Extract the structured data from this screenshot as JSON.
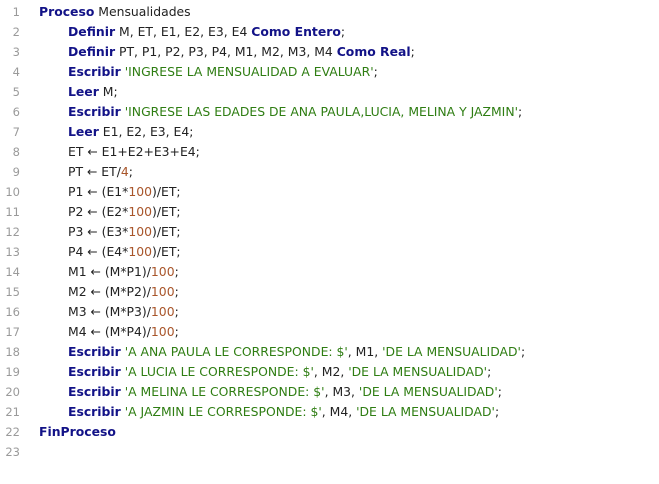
{
  "colors": {
    "keyword": "#121287",
    "string": "#2e7d12",
    "number": "#a8552a",
    "text": "#222222",
    "line_number": "#9a9a9a",
    "background": "#ffffff"
  },
  "lines": [
    {
      "n": "1",
      "indent": 0,
      "tokens": [
        {
          "t": "kw",
          "v": "Proceso"
        },
        {
          "t": "txt",
          "v": " Mensualidades"
        }
      ]
    },
    {
      "n": "2",
      "indent": 1,
      "tokens": [
        {
          "t": "kw",
          "v": "Definir"
        },
        {
          "t": "txt",
          "v": " M, ET, E1, E2, E3, E4 "
        },
        {
          "t": "kw",
          "v": "Como Entero"
        },
        {
          "t": "txt",
          "v": ";"
        }
      ]
    },
    {
      "n": "3",
      "indent": 1,
      "tokens": [
        {
          "t": "kw",
          "v": "Definir"
        },
        {
          "t": "txt",
          "v": " PT, P1, P2, P3, P4, M1, M2, M3, M4 "
        },
        {
          "t": "kw",
          "v": "Como Real"
        },
        {
          "t": "txt",
          "v": ";"
        }
      ]
    },
    {
      "n": "4",
      "indent": 1,
      "tokens": [
        {
          "t": "kw",
          "v": "Escribir"
        },
        {
          "t": "txt",
          "v": " "
        },
        {
          "t": "str",
          "v": "'INGRESE LA MENSUALIDAD A EVALUAR'"
        },
        {
          "t": "txt",
          "v": ";"
        }
      ]
    },
    {
      "n": "5",
      "indent": 1,
      "tokens": [
        {
          "t": "kw",
          "v": "Leer"
        },
        {
          "t": "txt",
          "v": " M;"
        }
      ]
    },
    {
      "n": "6",
      "indent": 1,
      "tokens": [
        {
          "t": "kw",
          "v": "Escribir"
        },
        {
          "t": "txt",
          "v": " "
        },
        {
          "t": "str",
          "v": "'INGRESE LAS EDADES DE ANA PAULA,LUCIA, MELINA Y JAZMIN'"
        },
        {
          "t": "txt",
          "v": ";"
        }
      ]
    },
    {
      "n": "7",
      "indent": 1,
      "tokens": [
        {
          "t": "kw",
          "v": "Leer"
        },
        {
          "t": "txt",
          "v": " E1, E2, E3, E4;"
        }
      ]
    },
    {
      "n": "8",
      "indent": 1,
      "tokens": [
        {
          "t": "txt",
          "v": "ET ← E1+E2+E3+E4;"
        }
      ]
    },
    {
      "n": "9",
      "indent": 1,
      "tokens": [
        {
          "t": "txt",
          "v": "PT ← ET/"
        },
        {
          "t": "num",
          "v": "4"
        },
        {
          "t": "txt",
          "v": ";"
        }
      ]
    },
    {
      "n": "10",
      "indent": 1,
      "tokens": [
        {
          "t": "txt",
          "v": "P1 ← (E1*"
        },
        {
          "t": "num",
          "v": "100"
        },
        {
          "t": "txt",
          "v": ")/ET;"
        }
      ]
    },
    {
      "n": "11",
      "indent": 1,
      "tokens": [
        {
          "t": "txt",
          "v": "P2 ← (E2*"
        },
        {
          "t": "num",
          "v": "100"
        },
        {
          "t": "txt",
          "v": ")/ET;"
        }
      ]
    },
    {
      "n": "12",
      "indent": 1,
      "tokens": [
        {
          "t": "txt",
          "v": "P3 ← (E3*"
        },
        {
          "t": "num",
          "v": "100"
        },
        {
          "t": "txt",
          "v": ")/ET;"
        }
      ]
    },
    {
      "n": "13",
      "indent": 1,
      "tokens": [
        {
          "t": "txt",
          "v": "P4 ← (E4*"
        },
        {
          "t": "num",
          "v": "100"
        },
        {
          "t": "txt",
          "v": ")/ET;"
        }
      ]
    },
    {
      "n": "14",
      "indent": 1,
      "tokens": [
        {
          "t": "txt",
          "v": "M1 ← (M*P1)/"
        },
        {
          "t": "num",
          "v": "100"
        },
        {
          "t": "txt",
          "v": ";"
        }
      ]
    },
    {
      "n": "15",
      "indent": 1,
      "tokens": [
        {
          "t": "txt",
          "v": "M2 ← (M*P2)/"
        },
        {
          "t": "num",
          "v": "100"
        },
        {
          "t": "txt",
          "v": ";"
        }
      ]
    },
    {
      "n": "16",
      "indent": 1,
      "tokens": [
        {
          "t": "txt",
          "v": "M3 ← (M*P3)/"
        },
        {
          "t": "num",
          "v": "100"
        },
        {
          "t": "txt",
          "v": ";"
        }
      ]
    },
    {
      "n": "17",
      "indent": 1,
      "tokens": [
        {
          "t": "txt",
          "v": "M4 ← (M*P4)/"
        },
        {
          "t": "num",
          "v": "100"
        },
        {
          "t": "txt",
          "v": ";"
        }
      ]
    },
    {
      "n": "18",
      "indent": 1,
      "tokens": [
        {
          "t": "kw",
          "v": "Escribir"
        },
        {
          "t": "txt",
          "v": " "
        },
        {
          "t": "str",
          "v": "'A ANA PAULA LE CORRESPONDE: $'"
        },
        {
          "t": "txt",
          "v": ", M1, "
        },
        {
          "t": "str",
          "v": "'DE LA MENSUALIDAD'"
        },
        {
          "t": "txt",
          "v": ";"
        }
      ]
    },
    {
      "n": "19",
      "indent": 1,
      "tokens": [
        {
          "t": "kw",
          "v": "Escribir"
        },
        {
          "t": "txt",
          "v": " "
        },
        {
          "t": "str",
          "v": "'A LUCIA LE CORRESPONDE: $'"
        },
        {
          "t": "txt",
          "v": ", M2, "
        },
        {
          "t": "str",
          "v": "'DE LA MENSUALIDAD'"
        },
        {
          "t": "txt",
          "v": ";"
        }
      ]
    },
    {
      "n": "20",
      "indent": 1,
      "tokens": [
        {
          "t": "kw",
          "v": "Escribir"
        },
        {
          "t": "txt",
          "v": " "
        },
        {
          "t": "str",
          "v": "'A MELINA LE CORRESPONDE: $'"
        },
        {
          "t": "txt",
          "v": ", M3, "
        },
        {
          "t": "str",
          "v": "'DE LA MENSUALIDAD'"
        },
        {
          "t": "txt",
          "v": ";"
        }
      ]
    },
    {
      "n": "21",
      "indent": 1,
      "tokens": [
        {
          "t": "kw",
          "v": "Escribir"
        },
        {
          "t": "txt",
          "v": " "
        },
        {
          "t": "str",
          "v": "'A JAZMIN LE CORRESPONDE: $'"
        },
        {
          "t": "txt",
          "v": ", M4, "
        },
        {
          "t": "str",
          "v": "'DE LA MENSUALIDAD'"
        },
        {
          "t": "txt",
          "v": ";"
        }
      ]
    },
    {
      "n": "22",
      "indent": 0,
      "tokens": [
        {
          "t": "kw",
          "v": "FinProceso"
        }
      ]
    },
    {
      "n": "23",
      "indent": 0,
      "tokens": []
    }
  ]
}
